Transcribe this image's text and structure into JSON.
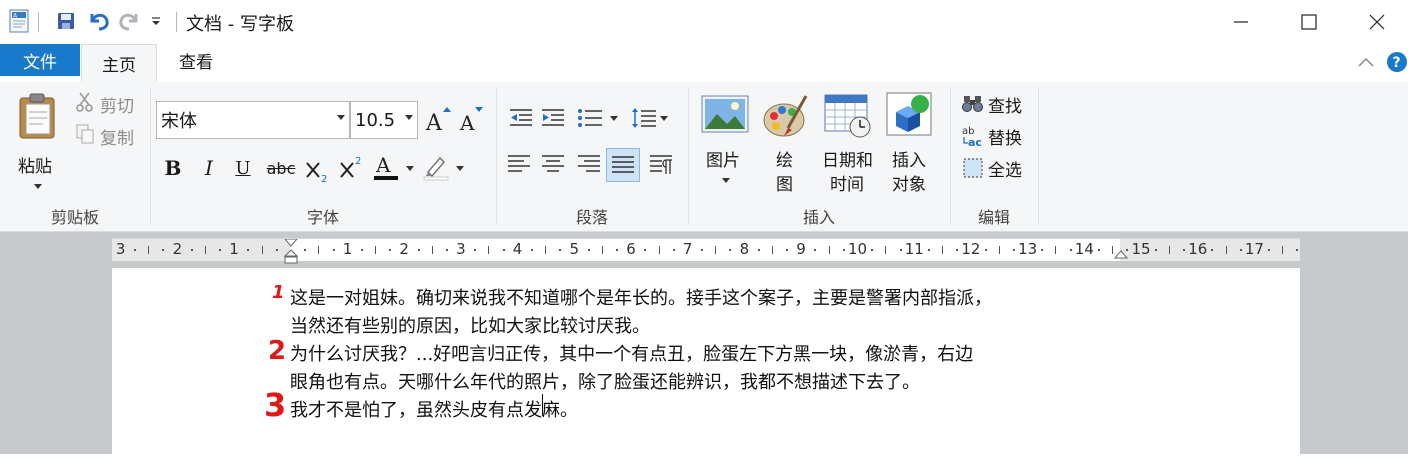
{
  "window": {
    "title": "文档 - 写字板"
  },
  "tabs": {
    "file": "文件",
    "home": "主页",
    "view": "查看"
  },
  "clipboard": {
    "paste": "粘贴",
    "cut": "剪切",
    "copy": "复制",
    "group_label": "剪贴板"
  },
  "font": {
    "family": "宋体",
    "size": "10.5",
    "bold": "B",
    "italic": "I",
    "underline": "U",
    "strike": "abc",
    "group_label": "字体"
  },
  "paragraph": {
    "group_label": "段落"
  },
  "insert": {
    "picture": "图片",
    "paint_1": "绘",
    "paint_2": "图",
    "datetime_1": "日期和",
    "datetime_2": "时间",
    "object_1": "插入",
    "object_2": "对象",
    "group_label": "插入"
  },
  "editing": {
    "find": "查找",
    "replace": "替换",
    "select_all": "全选",
    "group_label": "编辑"
  },
  "ruler": {
    "labels": [
      "3",
      "2",
      "1",
      "1",
      "2",
      "3",
      "4",
      "5",
      "6",
      "7",
      "8",
      "9",
      "10",
      "11",
      "12",
      "13",
      "14",
      "15",
      "16",
      "17"
    ]
  },
  "document": {
    "lines": [
      "这是一对姐妹。确切来说我不知道哪个是年长的。接手这个案子，主要是警署内部指派，",
      "当然还有些别的原因，比如大家比较讨厌我。",
      "为什么讨厌我？...好吧言归正传，其中一个有点丑，脸蛋左下方黑一块，像淤青，右边",
      "眼角也有点。天哪什么年代的照片，除了脸蛋还能辨识，我都不想描述下去了。",
      "我才不是怕了，虽然头皮有点发麻。"
    ],
    "annotations": [
      "1",
      "2",
      "3"
    ]
  },
  "colors": {
    "file_tab": "#1979ca",
    "annotation_red": "#e01818",
    "doc_background": "#c6cacd",
    "help_blue": "#1979ca"
  }
}
